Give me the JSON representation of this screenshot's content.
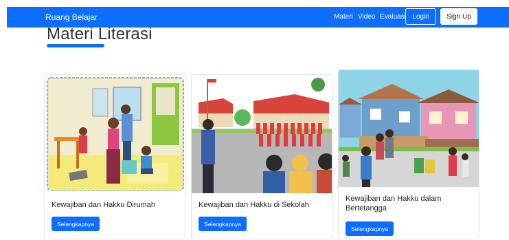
{
  "navbar": {
    "brand": "Ruang Belajar",
    "links": [
      "Materi",
      "Video",
      "Evaluasi"
    ],
    "login_label": "Login",
    "signup_label": "Sign Up"
  },
  "page": {
    "title": "Materi Literasi"
  },
  "cards": [
    {
      "title": "Kewajiban dan Hakku Dirumah",
      "button": "Selengkapnya"
    },
    {
      "title": "Kewajiban dan Hakku di Sekolah",
      "button": "Selengkapnya"
    },
    {
      "title_line1": "Kewajiban dan Hakku dalam",
      "title_line2": "Bertetangga",
      "button": "Selengkapnya"
    }
  ],
  "colors": {
    "primary": "#0d6efd"
  }
}
